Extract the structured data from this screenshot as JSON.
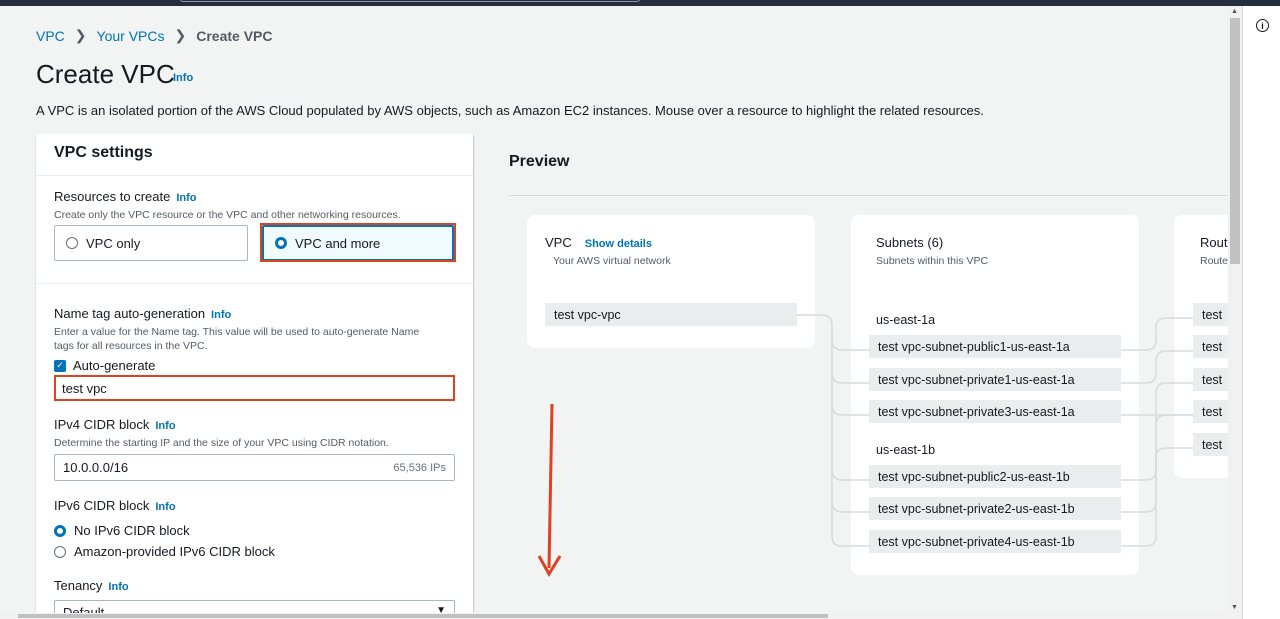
{
  "breadcrumb": {
    "vpc": "VPC",
    "your_vpcs": "Your VPCs",
    "current": "Create VPC",
    "separator": "❯"
  },
  "page": {
    "title": "Create VPC",
    "info": "Info",
    "description": "A VPC is an isolated portion of the AWS Cloud populated by AWS objects, such as Amazon EC2 instances. Mouse over a resource to highlight the related resources."
  },
  "settings": {
    "header": "VPC settings",
    "resources": {
      "label": "Resources to create",
      "info": "Info",
      "hint": "Create only the VPC resource or the VPC and other networking resources.",
      "option_vpc_only": "VPC only",
      "option_vpc_more": "VPC and more"
    },
    "name_tag": {
      "label": "Name tag auto-generation",
      "info": "Info",
      "hint_line1": "Enter a value for the Name tag. This value will be used to auto-generate Name",
      "hint_line2": "tags for all resources in the VPC.",
      "checkbox_label": "Auto-generate",
      "value": "test vpc"
    },
    "ipv4": {
      "label": "IPv4 CIDR block",
      "info": "Info",
      "hint": "Determine the starting IP and the size of your VPC using CIDR notation.",
      "value": "10.0.0.0/16",
      "ip_count": "65,536 IPs"
    },
    "ipv6": {
      "label": "IPv6 CIDR block",
      "info": "Info",
      "option_none": "No IPv6 CIDR block",
      "option_amazon": "Amazon-provided IPv6 CIDR block"
    },
    "tenancy": {
      "label": "Tenancy",
      "info": "Info",
      "value": "Default"
    }
  },
  "preview": {
    "title": "Preview",
    "vpc_card": {
      "title": "VPC",
      "show_details": "Show details",
      "subtitle": "Your AWS virtual network",
      "vpc_name": "test vpc-vpc"
    },
    "subnets_card": {
      "title": "Subnets (6)",
      "subtitle": "Subnets within this VPC",
      "az1": "us-east-1a",
      "az2": "us-east-1b",
      "subnets": [
        "test vpc-subnet-public1-us-east-1a",
        "test vpc-subnet-private1-us-east-1a",
        "test vpc-subnet-private3-us-east-1a",
        "test vpc-subnet-public2-us-east-1b",
        "test vpc-subnet-private2-us-east-1b",
        "test vpc-subnet-private4-us-east-1b"
      ]
    },
    "route_card": {
      "title": "Rout",
      "subtitle": "Route",
      "items": [
        "test",
        "test",
        "test",
        "test",
        "test"
      ]
    }
  },
  "rail": {
    "info_icon": "i"
  },
  "scroll": {
    "up": "▲",
    "down": "▼"
  },
  "colors": {
    "accent": "#0073bb",
    "annotation": "#e0411f",
    "background": "#f2f3f3"
  },
  "icons": [
    "info-icon",
    "chevron-right-icon",
    "caret-down-icon",
    "checkmark-icon",
    "down-arrow-annotation-icon"
  ]
}
